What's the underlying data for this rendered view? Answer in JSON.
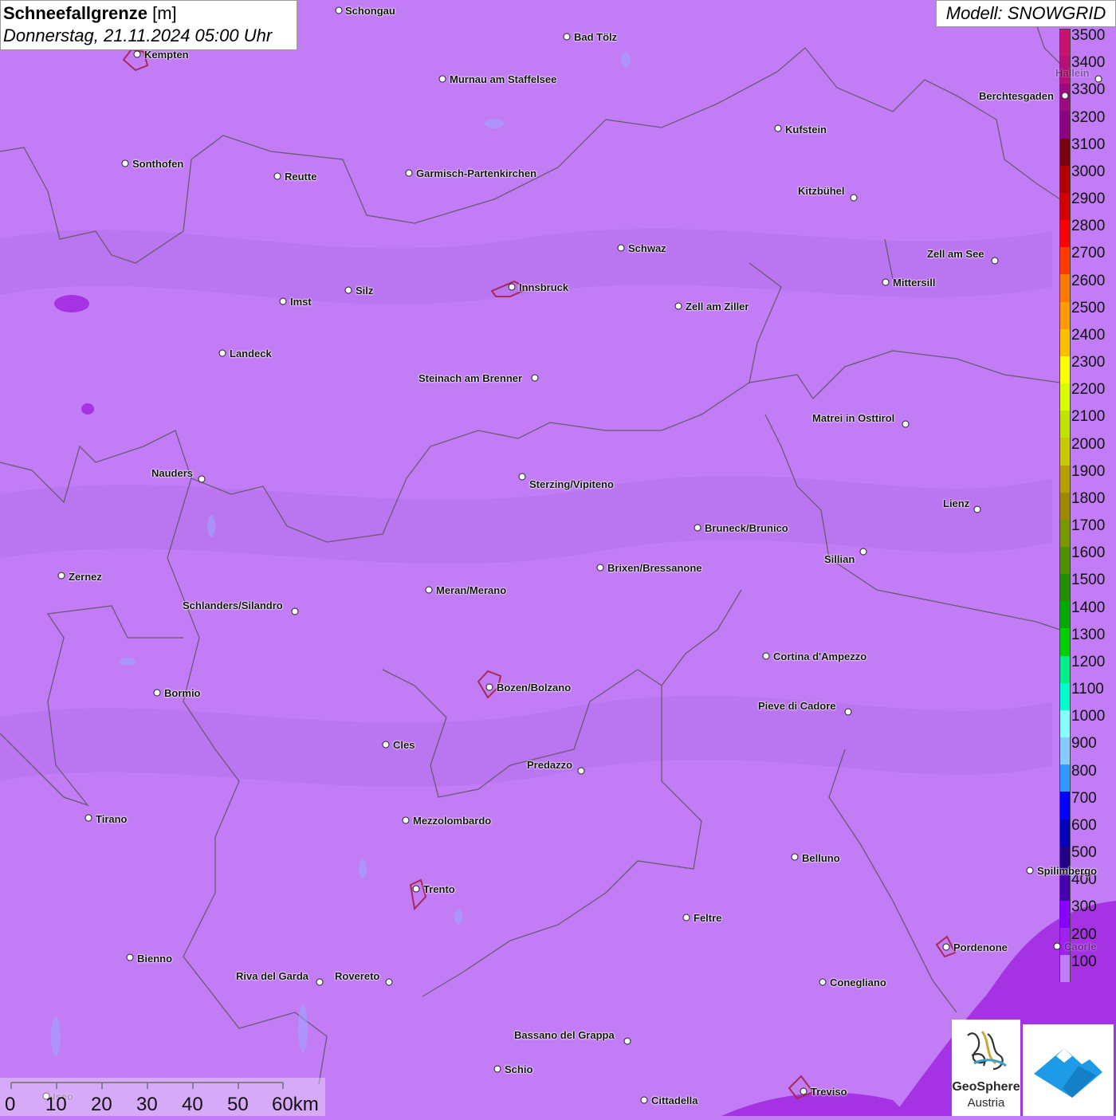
{
  "title": {
    "param": "Schneefallgrenze",
    "unit": "[m]",
    "datetime": "Donnerstag, 21.11.2024 05:00 Uhr"
  },
  "model": "Modell: SNOWGRID",
  "legend": {
    "labels": [
      "3500",
      "3400",
      "3300",
      "3200",
      "3100",
      "3000",
      "2900",
      "2800",
      "2700",
      "2600",
      "2500",
      "2400",
      "2300",
      "2200",
      "2100",
      "2000",
      "1900",
      "1800",
      "1700",
      "1600",
      "1500",
      "1400",
      "1300",
      "1200",
      "1100",
      "1000",
      "900",
      "800",
      "700",
      "600",
      "500",
      "400",
      "300",
      "200",
      "100"
    ],
    "colors": [
      "#c8146e",
      "#b80e78",
      "#a0087f",
      "#8a0680",
      "#7a0010",
      "#b00000",
      "#d40000",
      "#ff0000",
      "#ff3c00",
      "#ff7800",
      "#ff9b00",
      "#ffc000",
      "#ffff00",
      "#d8ff00",
      "#c0e400",
      "#c8c800",
      "#b8a000",
      "#a08800",
      "#789800",
      "#509000",
      "#209000",
      "#00aa00",
      "#00d000",
      "#00ee88",
      "#00ffcc",
      "#88ffff",
      "#88ccff",
      "#3399ff",
      "#0000ff",
      "#0000bb",
      "#220088",
      "#4400aa",
      "#8800ff",
      "#a020f0",
      "#c17cf6"
    ]
  },
  "map_base_color": "#c17cf6",
  "cities": [
    {
      "name": "Schongau"
    },
    {
      "name": "Bad Tölz"
    },
    {
      "name": "Kempten"
    },
    {
      "name": "Murnau am Staffelsee"
    },
    {
      "name": "Hallein"
    },
    {
      "name": "Berchtesgaden"
    },
    {
      "name": "Kufstein"
    },
    {
      "name": "Sonthofen"
    },
    {
      "name": "Reutte"
    },
    {
      "name": "Garmisch-Partenkirchen"
    },
    {
      "name": "Kitzbühel"
    },
    {
      "name": "Schwaz"
    },
    {
      "name": "Zell am See"
    },
    {
      "name": "Innsbruck"
    },
    {
      "name": "Mittersill"
    },
    {
      "name": "Silz"
    },
    {
      "name": "Imst"
    },
    {
      "name": "Zell am Ziller"
    },
    {
      "name": "Landeck"
    },
    {
      "name": "Steinach am Brenner"
    },
    {
      "name": "Matrei in Osttirol"
    },
    {
      "name": "Nauders"
    },
    {
      "name": "Sterzing/Vipiteno"
    },
    {
      "name": "Lienz"
    },
    {
      "name": "Bruneck/Brunico"
    },
    {
      "name": "Sillian"
    },
    {
      "name": "Brixen/Bressanone"
    },
    {
      "name": "Zernez"
    },
    {
      "name": "Meran/Merano"
    },
    {
      "name": "Schlanders/Silandro"
    },
    {
      "name": "Cortina d'Ampezzo"
    },
    {
      "name": "Bozen/Bolzano"
    },
    {
      "name": "Bormio"
    },
    {
      "name": "Pieve di Cadore"
    },
    {
      "name": "Cles"
    },
    {
      "name": "Predazzo"
    },
    {
      "name": "Tirano"
    },
    {
      "name": "Mezzolombardo"
    },
    {
      "name": "Belluno"
    },
    {
      "name": "Spilimbergo"
    },
    {
      "name": "Trento"
    },
    {
      "name": "Feltre"
    },
    {
      "name": "Pordenone"
    },
    {
      "name": "Bienno"
    },
    {
      "name": "Riva del Garda"
    },
    {
      "name": "Rovereto"
    },
    {
      "name": "Conegliano"
    },
    {
      "name": "Bassano del Grappa"
    },
    {
      "name": "Schio"
    },
    {
      "name": "Treviso"
    },
    {
      "name": "Cittadella"
    },
    {
      "name": "Iseo"
    },
    {
      "name": "Caorle"
    }
  ],
  "scalebar": {
    "labels": [
      "0",
      "10",
      "20",
      "30",
      "40",
      "50",
      "60km"
    ]
  },
  "logos": {
    "geosphere_line1": "GeoSphere",
    "geosphere_line2": "Austria"
  }
}
